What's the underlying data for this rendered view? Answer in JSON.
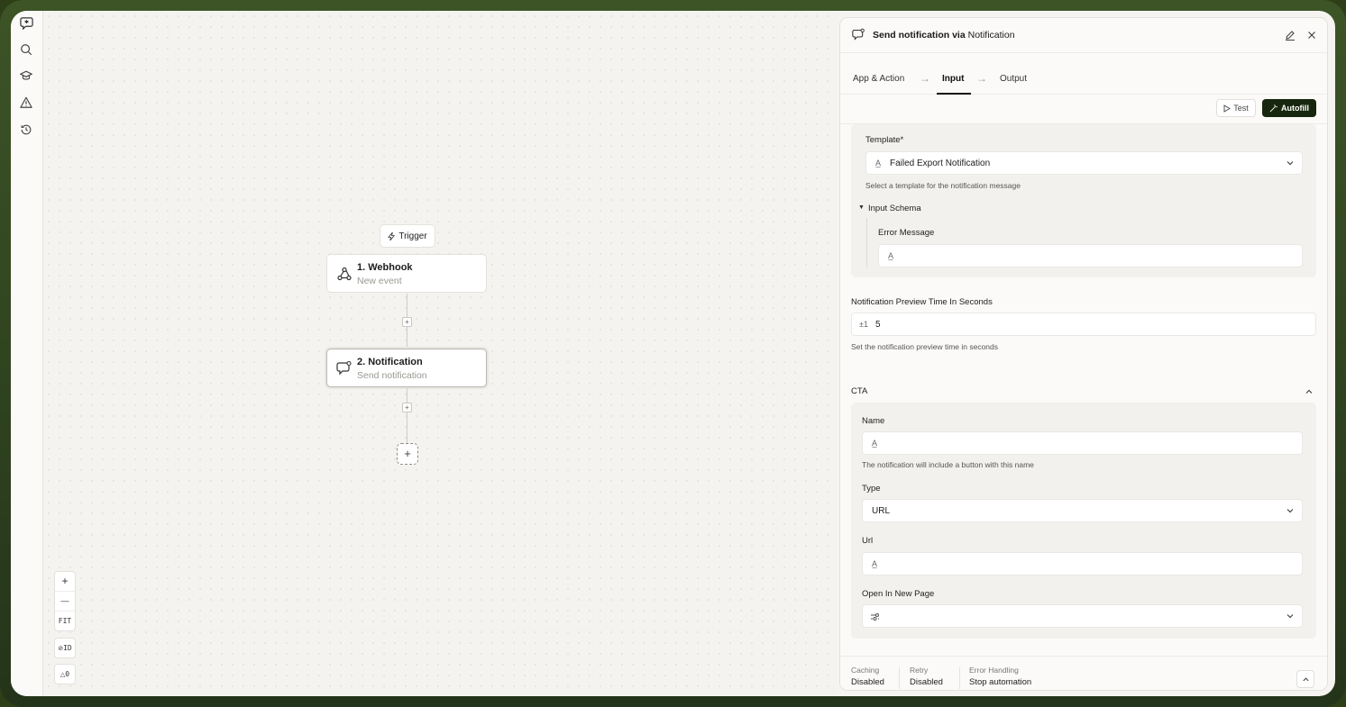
{
  "rail": {
    "icons": [
      "logo-icon",
      "search-icon",
      "courses-icon",
      "warning-icon",
      "history-icon"
    ]
  },
  "canvas": {
    "trigger_label": "Trigger",
    "nodes": [
      {
        "title": "1. Webhook",
        "subtitle": "New event",
        "icon": "webhook-icon"
      },
      {
        "title": "2. Notification",
        "subtitle": "Send notification",
        "icon": "notification-icon"
      }
    ],
    "zoom": {
      "in": "+",
      "out": "—",
      "fit": "FIT"
    },
    "id_toggle": "ID",
    "warnings": "0"
  },
  "panel": {
    "title_prefix": "Send notification via",
    "title_app": "Notification",
    "tabs": [
      "App & Action",
      "Input",
      "Output"
    ],
    "active_tab": "Input",
    "test_label": "Test",
    "autofill_label": "Autofill",
    "template": {
      "label": "Template*",
      "value": "Failed Export Notification",
      "help": "Select a template for the notification message"
    },
    "input_schema": {
      "label": "Input Schema",
      "error_message_label": "Error Message",
      "error_message_value": ""
    },
    "preview_time": {
      "label": "Notification Preview Time In Seconds",
      "prefix": "±1",
      "value": "5",
      "help": "Set the notification preview time in seconds"
    },
    "cta": {
      "section_label": "CTA",
      "name_label": "Name",
      "name_value": "",
      "name_help": "The notification will include a button with this name",
      "type_label": "Type",
      "type_value": "URL",
      "url_label": "Url",
      "url_value": "",
      "open_new_label": "Open In New Page",
      "open_new_value": ""
    },
    "footer": [
      {
        "key": "Caching",
        "value": "Disabled"
      },
      {
        "key": "Retry",
        "value": "Disabled"
      },
      {
        "key": "Error Handling",
        "value": "Stop automation"
      }
    ]
  }
}
